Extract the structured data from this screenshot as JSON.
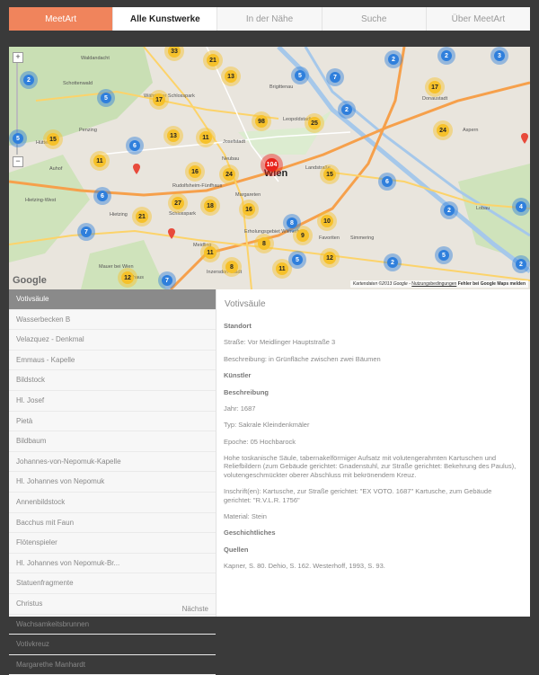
{
  "nav": {
    "brand": "MeetArt",
    "items": [
      "Alle Kunstwerke",
      "In der Nähe",
      "Suche",
      "Über MeetArt"
    ]
  },
  "map": {
    "city": "Wien",
    "google": "Google",
    "attribution": "Kartendaten ©2013 Google -",
    "attribution_link": "Nutzungsbedingungen",
    "attribution_error": "Fehler bei Google Maps melden",
    "districts": [
      "Schottenwald",
      "Penzing",
      "Hütteldorf",
      "Auhof",
      "Hietzing-West",
      "Hietzing",
      "Mauer bei Wien",
      "Neuhaus",
      "Brigittenau",
      "Leopoldstadt",
      "Josefstadt",
      "Neubau",
      "Landstraße",
      "Margareten",
      "Meidling",
      "Favoriten",
      "Simmering",
      "Donaustadt",
      "Aspern",
      "Lobau",
      "Schlosspark",
      "Inzersdorf-Stadt",
      "Erholungsgebiet Wienerberg",
      "Rudolfsheim-Fünfhaus",
      "Währinger Schlosspark",
      "Waldandacht"
    ],
    "clusters_yellow": [
      "33",
      "21",
      "13",
      "17",
      "17",
      "98",
      "11",
      "15",
      "13",
      "11",
      "25",
      "16",
      "24",
      "11",
      "15",
      "18",
      "16",
      "21",
      "13",
      "10",
      "9",
      "8",
      "27",
      "12",
      "8",
      "11",
      "12"
    ],
    "clusters_blue": [
      "2",
      "5",
      "5",
      "7",
      "3",
      "2",
      "2",
      "6",
      "5",
      "6",
      "7",
      "4",
      "2",
      "7",
      "5",
      "2",
      "5",
      "2",
      "8",
      "6",
      "2"
    ],
    "cluster_red": "104"
  },
  "list": {
    "selected": "Votivsäule",
    "items": [
      "Votivsäule",
      "Wasserbecken B",
      "Velazquez - Denkmal",
      "Emmaus - Kapelle",
      "Bildstock",
      "Hl. Josef",
      "Pietà",
      "Bildbaum",
      "Johannes-von-Nepomuk-Kapelle",
      "Hl. Johannes von Nepomuk",
      "Annenbildstock",
      "Bacchus mit Faun",
      "Flötenspieler",
      "Hl. Johannes von Nepomuk-Br...",
      "Statuenfragmente",
      "Christus",
      "Wachsamkeitsbrunnen",
      "Votivkreuz",
      "Margarethe Manhardt"
    ],
    "next": "Nächste"
  },
  "detail": {
    "title": "Votivsäule",
    "standort_head": "Standort",
    "strasse": "Straße: Vor Meidlinger Hauptstraße 3",
    "beschreibung_loc": "Beschreibung: in Grünfläche zwischen zwei Bäumen",
    "kuenstler_head": "Künstler",
    "beschreibung_head": "Beschreibung",
    "jahr": "Jahr: 1687",
    "typ": "Typ: Sakrale Kleindenkmäler",
    "epoche": "Epoche: 05 Hochbarock",
    "text1": "Hohe toskanische Säule, tabernakelförmiger Aufsatz mit volutengerahmten Kartuschen und Reliefbildern (zum Gebäude gerichtet: Gnadenstuhl, zur Straße gerichtet: Bekehrung des Paulus), volutengeschmückter oberer Abschluss mit bekrönendem Kreuz.",
    "inschrift": "Inschrift(en): Kartusche, zur Straße gerichtet: \"EX VOTO. 1687\" Kartusche, zum Gebäude gerichtet: \"R.V.L.R. 1756\"",
    "material": "Material: Stein",
    "geschichte_head": "Geschichtliches",
    "quellen_head": "Quellen",
    "quellen": "Kapner, S. 80. Dehio, S. 162. Westerhoff, 1993, S. 93."
  }
}
